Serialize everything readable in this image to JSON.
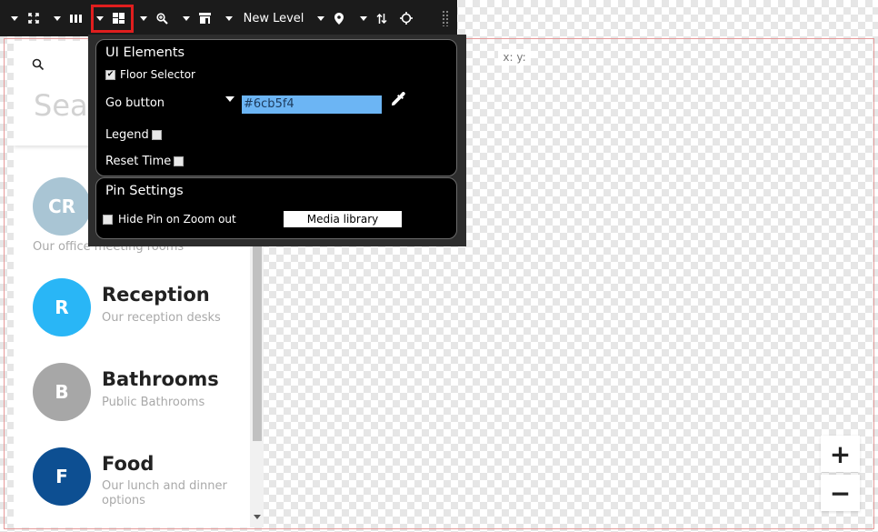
{
  "toolbar": {
    "level_label": "New Level",
    "icons": [
      "fullscreen-icon",
      "columns-icon",
      "layout-icon",
      "zoom-icon",
      "store-icon",
      "pin-icon",
      "swap-icon",
      "target-icon",
      "drag-handle-icon"
    ],
    "active_item": "layout-icon",
    "active_color": "#e01e1e"
  },
  "coords": {
    "text": "x: y:"
  },
  "popup": {
    "ui_elements": {
      "title": "UI Elements",
      "floor_selector": {
        "label": "Floor Selector",
        "checked": true
      },
      "go_button": {
        "label": "Go button",
        "color_value": "#6cb5f4"
      },
      "legend": {
        "label": "Legend",
        "checked": false
      },
      "reset_time": {
        "label": "Reset Time",
        "checked": false
      }
    },
    "pin_settings": {
      "title": "Pin Settings",
      "hide_pin": {
        "label": "Hide Pin on Zoom out",
        "checked": false
      },
      "media_library_label": "Media library"
    }
  },
  "search": {
    "placeholder": "Sea"
  },
  "categories": [
    {
      "initials": "CR",
      "title": "",
      "subtitle": "Our office meeting rooms",
      "color": "#a9c5d4"
    },
    {
      "initials": "R",
      "title": "Reception",
      "subtitle": "Our reception desks",
      "color": "#29b6f6"
    },
    {
      "initials": "B",
      "title": "Bathrooms",
      "subtitle": "Public Bathrooms",
      "color": "#a7a7a7"
    },
    {
      "initials": "F",
      "title": "Food",
      "subtitle": "Our lunch and dinner options",
      "color": "#0d4f92"
    }
  ],
  "zoom": {
    "in_label": "+",
    "out_label": "−"
  }
}
